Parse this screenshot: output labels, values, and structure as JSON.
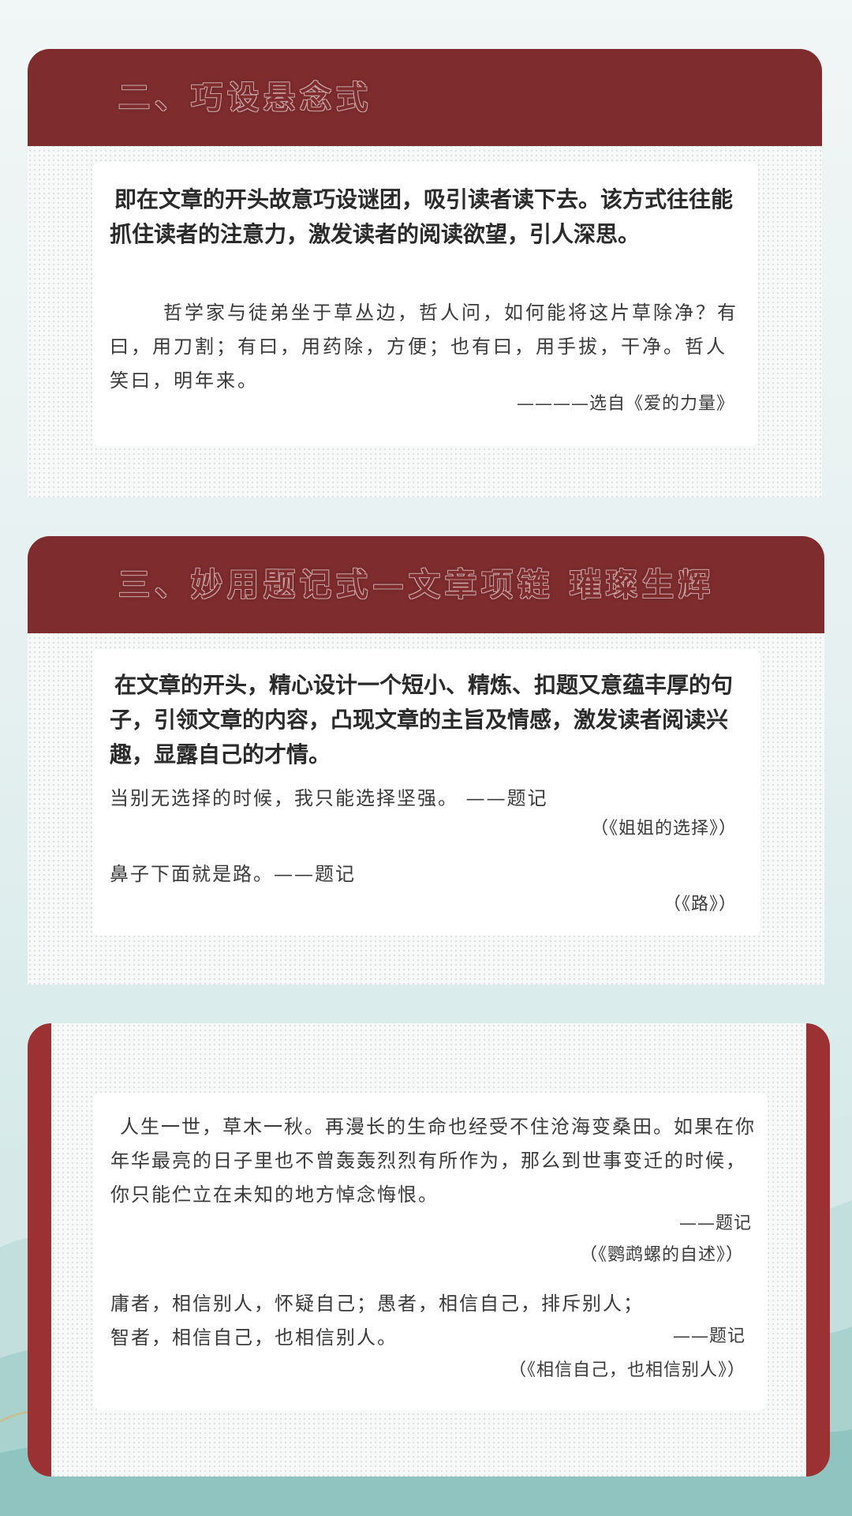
{
  "section2": {
    "title": "二、巧设悬念式",
    "intro": "即在文章的开头故意巧设谜团，吸引读者读下去。该方式往往能抓住读者的注意力，激发读者的阅读欲望，引人深思。",
    "example": "哲学家与徒弟坐于草丛边，哲人问，如何能将这片草除净？有曰，用刀割；有曰，用药除，方便；也有曰，用手拔，干净。哲人笑曰，明年来。",
    "source": "————选自《爱的力量》"
  },
  "section3": {
    "title": "三、妙用题记式—文章项链  璀璨生辉",
    "intro": "在文章的开头，精心设计一个短小、精炼、扣题又意蕴丰厚的句子，引领文章的内容，凸现文章的主旨及情感，激发读者阅读兴趣，显露自己的才情。",
    "example1": "当别无选择的时候，我只能选择坚强。 ——题记",
    "source1": "（《姐姐的选择》）",
    "example2": "鼻子下面就是路。——题记",
    "source2": "（《路》）"
  },
  "section4": {
    "example1": "人生一世，草木一秋。再漫长的生命也经受不住沧海变桑田。如果在你年华最亮的日子里也不曾轰轰烈烈有所作为，那么到世事变迁的时候，你只能伫立在未知的地方悼念悔恨。",
    "tag1": "——题记",
    "source1": "（《鹦鹉螺的自述》）",
    "example2_line1": "庸者，相信别人，怀疑自己；愚者，相信自己，排斥别人；",
    "example2_line2": "智者，相信自己，也相信别人。",
    "tag2": "——题记",
    "source2": "（《相信自己，也相信别人》）"
  },
  "colors": {
    "header": "#7e2c2e",
    "side": "#9b3133",
    "text": "#2a2a2a"
  }
}
